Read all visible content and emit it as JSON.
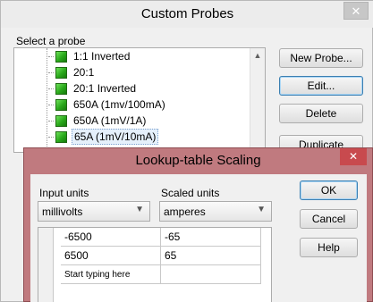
{
  "probes_dialog": {
    "title": "Custom Probes",
    "close_glyph": "✕",
    "select_label": "Select a probe",
    "tree_items": [
      {
        "label": "1:1 Inverted",
        "selected": false
      },
      {
        "label": "20:1",
        "selected": false
      },
      {
        "label": "20:1 Inverted",
        "selected": false
      },
      {
        "label": "650A (1mv/100mA)",
        "selected": false
      },
      {
        "label": "650A (1mV/1A)",
        "selected": false
      },
      {
        "label": "65A (1mV/10mA)",
        "selected": true
      }
    ],
    "scroll_up_glyph": "▲",
    "buttons": {
      "new_probe": "New Probe...",
      "edit": "Edit...",
      "delete": "Delete",
      "duplicate": "Duplicate"
    },
    "icon": "green-probe-icon"
  },
  "scaling_dialog": {
    "title": "Lookup-table Scaling",
    "close_glyph": "✕",
    "input_units_label": "Input units",
    "scaled_units_label": "Scaled units",
    "input_units_value": "millivolts",
    "scaled_units_value": "amperes",
    "dropdown_glyph": "▼",
    "table_rows": [
      {
        "input": "-6500",
        "scaled": "-65"
      },
      {
        "input": "6500",
        "scaled": "65"
      },
      {
        "input": "Start typing here",
        "scaled": ""
      }
    ],
    "buttons": {
      "ok": "OK",
      "cancel": "Cancel",
      "help": "Help"
    }
  },
  "colors": {
    "dialog_accent": "#c07a7f",
    "close_button": "#c84a4e",
    "probe_icon_green": "#29a81a"
  }
}
